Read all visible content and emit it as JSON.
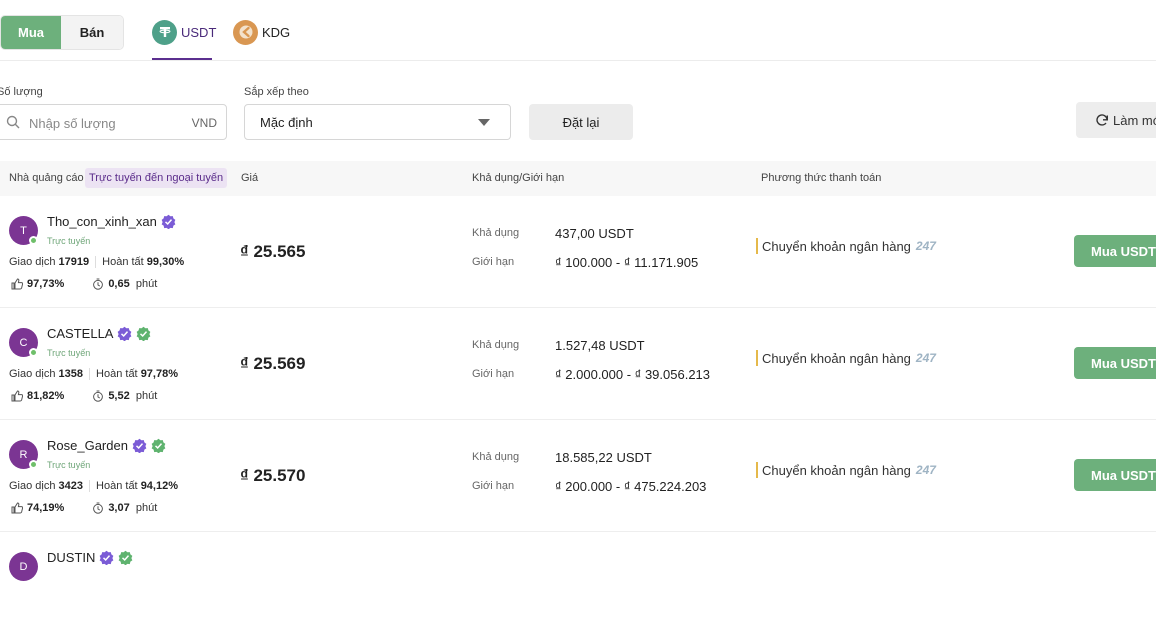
{
  "toggle": {
    "buy": "Mua",
    "sell": "Bán"
  },
  "coins": [
    {
      "label": "USDT",
      "icon": "tether-icon"
    },
    {
      "label": "KDG",
      "icon": "kdg-icon"
    }
  ],
  "filters": {
    "amount_label": "Số lượng",
    "amount_placeholder": "Nhập số lượng",
    "amount_unit": "VND",
    "sort_label": "Sắp xếp theo",
    "sort_value": "Mặc định",
    "reset": "Đặt lại",
    "refresh": "Làm mới"
  },
  "table": {
    "col_advertiser": "Nhà quảng cáo",
    "online_filter": "Trực tuyến đến ngoại tuyến",
    "col_price": "Giá",
    "col_available": "Khả dụng/Giới hạn",
    "col_payment": "Phương thức thanh toán"
  },
  "labels": {
    "trades": "Giao dịch",
    "completion": "Hoàn tất",
    "minute": "phút",
    "available": "Khả dụng",
    "limit": "Giới hạn",
    "buy_button": "Mua USDT"
  },
  "rows": [
    {
      "initial": "T",
      "name": "Tho_con_xinh_xan",
      "verified": true,
      "merchant": false,
      "status": "Trực tuyến",
      "trades": "17919",
      "completion": "99,30%",
      "positive": "97,73%",
      "time": "0,65",
      "price": "₫ 25.565",
      "available": "437,00 USDT",
      "limit": "₫ 100.000 - ₫ 11.171.905",
      "payment": "Chuyển khoản ngân hàng",
      "payment_tag": "247"
    },
    {
      "initial": "C",
      "name": "CASTELLA",
      "verified": true,
      "merchant": true,
      "status": "Trực tuyến",
      "trades": "1358",
      "completion": "97,78%",
      "positive": "81,82%",
      "time": "5,52",
      "price": "₫ 25.569",
      "available": "1.527,48 USDT",
      "limit": "₫ 2.000.000 - ₫ 39.056.213",
      "payment": "Chuyển khoản ngân hàng",
      "payment_tag": "247"
    },
    {
      "initial": "R",
      "name": "Rose_Garden",
      "verified": true,
      "merchant": true,
      "status": "Trực tuyến",
      "trades": "3423",
      "completion": "94,12%",
      "positive": "74,19%",
      "time": "3,07",
      "price": "₫ 25.570",
      "available": "18.585,22 USDT",
      "limit": "₫ 200.000 - ₫ 475.224.203",
      "payment": "Chuyển khoản ngân hàng",
      "payment_tag": "247"
    },
    {
      "initial": "D",
      "name": "DUSTIN",
      "verified": true,
      "merchant": true
    }
  ],
  "colors": {
    "buy_green": "#6db07c",
    "brand_purple": "#5b2f8f",
    "verified_purple": "#7b5cd6",
    "merchant_green": "#5fb36f",
    "avatar_purple": "#7b3593"
  }
}
